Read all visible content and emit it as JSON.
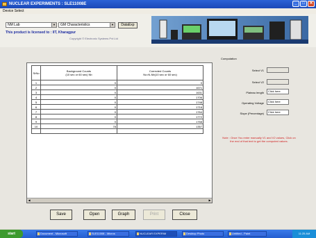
{
  "window": {
    "title": "NUCLEAR EXPERIMENTS : SLE11008E",
    "controls": [
      "_",
      "□",
      "✕"
    ]
  },
  "menu": {
    "label": "Device Select"
  },
  "header": {
    "select1": "NM Lab",
    "select2": "GM Characteristics",
    "data_export": "DataExp",
    "org_line": "This product is licensed to : IIT, Kharagpur",
    "copyright": "Copyright © Electronic Systems Pvt Ltd"
  },
  "table": {
    "headers": {
      "sr": "SrNo",
      "background": "Background Counts\n(10 sec or 60 sec) Nb",
      "corrected": "Corrected Counts\nNc=N-Nb(10 sec or 60 sec)"
    },
    "rows": [
      {
        "sr": "1",
        "bg": "0",
        "cc": "0"
      },
      {
        "sr": "2",
        "bg": "0",
        "cc": "1671"
      },
      {
        "sr": "3",
        "bg": "0",
        "cc": "1631"
      },
      {
        "sr": "4",
        "bg": "0",
        "cc": "1706"
      },
      {
        "sr": "5",
        "bg": "0",
        "cc": "1748"
      },
      {
        "sr": "6",
        "bg": "0",
        "cc": "1716"
      },
      {
        "sr": "7",
        "bg": "0",
        "cc": "1764"
      },
      {
        "sr": "8",
        "bg": "0",
        "cc": "1772"
      },
      {
        "sr": "9",
        "bg": "0",
        "cc": "1768"
      },
      {
        "sr": "10",
        "bg": "78",
        "cc": "1357"
      },
      {
        "sr": "",
        "bg": "",
        "cc": ""
      }
    ]
  },
  "computation": {
    "title": "Computation",
    "fields": [
      {
        "label": "Select V1",
        "value": "",
        "disabled": true
      },
      {
        "label": "Select V2",
        "value": "",
        "disabled": true
      },
      {
        "label": "Plateau length",
        "value": "Click here",
        "disabled": false
      },
      {
        "label": "Operating Voltage",
        "value": "Click here",
        "disabled": false
      },
      {
        "label": "Slope (Percentage)",
        "value": "Click here",
        "disabled": false
      }
    ]
  },
  "note": "Note : Once You enter manually V1 and V2 values, Click on the end of that text to get the computed values.",
  "buttons": {
    "save": "Save",
    "open": "Open",
    "graph": "Graph",
    "print": "Print",
    "close": "Close"
  },
  "taskbar": {
    "start": "start",
    "tasks": [
      "Document - Microsoft",
      "SLE11008 - Micros",
      "NUCLEAR EXPERIM",
      "Desktop Photo",
      "Untitled - Paint"
    ],
    "clock": "11:25 AM"
  },
  "colors": {
    "title_bar": "#1a48b8",
    "note_text": "#d02020",
    "org_text": "#1c2ba0"
  }
}
